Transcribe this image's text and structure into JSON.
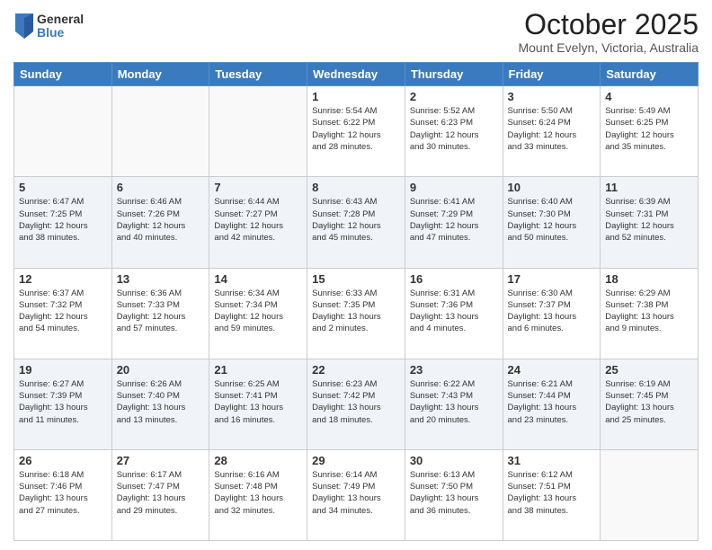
{
  "logo": {
    "general": "General",
    "blue": "Blue"
  },
  "header": {
    "month": "October 2025",
    "location": "Mount Evelyn, Victoria, Australia"
  },
  "days_of_week": [
    "Sunday",
    "Monday",
    "Tuesday",
    "Wednesday",
    "Thursday",
    "Friday",
    "Saturday"
  ],
  "weeks": [
    [
      {
        "day": "",
        "info": ""
      },
      {
        "day": "",
        "info": ""
      },
      {
        "day": "",
        "info": ""
      },
      {
        "day": "1",
        "info": "Sunrise: 5:54 AM\nSunset: 6:22 PM\nDaylight: 12 hours\nand 28 minutes."
      },
      {
        "day": "2",
        "info": "Sunrise: 5:52 AM\nSunset: 6:23 PM\nDaylight: 12 hours\nand 30 minutes."
      },
      {
        "day": "3",
        "info": "Sunrise: 5:50 AM\nSunset: 6:24 PM\nDaylight: 12 hours\nand 33 minutes."
      },
      {
        "day": "4",
        "info": "Sunrise: 5:49 AM\nSunset: 6:25 PM\nDaylight: 12 hours\nand 35 minutes."
      }
    ],
    [
      {
        "day": "5",
        "info": "Sunrise: 6:47 AM\nSunset: 7:25 PM\nDaylight: 12 hours\nand 38 minutes."
      },
      {
        "day": "6",
        "info": "Sunrise: 6:46 AM\nSunset: 7:26 PM\nDaylight: 12 hours\nand 40 minutes."
      },
      {
        "day": "7",
        "info": "Sunrise: 6:44 AM\nSunset: 7:27 PM\nDaylight: 12 hours\nand 42 minutes."
      },
      {
        "day": "8",
        "info": "Sunrise: 6:43 AM\nSunset: 7:28 PM\nDaylight: 12 hours\nand 45 minutes."
      },
      {
        "day": "9",
        "info": "Sunrise: 6:41 AM\nSunset: 7:29 PM\nDaylight: 12 hours\nand 47 minutes."
      },
      {
        "day": "10",
        "info": "Sunrise: 6:40 AM\nSunset: 7:30 PM\nDaylight: 12 hours\nand 50 minutes."
      },
      {
        "day": "11",
        "info": "Sunrise: 6:39 AM\nSunset: 7:31 PM\nDaylight: 12 hours\nand 52 minutes."
      }
    ],
    [
      {
        "day": "12",
        "info": "Sunrise: 6:37 AM\nSunset: 7:32 PM\nDaylight: 12 hours\nand 54 minutes."
      },
      {
        "day": "13",
        "info": "Sunrise: 6:36 AM\nSunset: 7:33 PM\nDaylight: 12 hours\nand 57 minutes."
      },
      {
        "day": "14",
        "info": "Sunrise: 6:34 AM\nSunset: 7:34 PM\nDaylight: 12 hours\nand 59 minutes."
      },
      {
        "day": "15",
        "info": "Sunrise: 6:33 AM\nSunset: 7:35 PM\nDaylight: 13 hours\nand 2 minutes."
      },
      {
        "day": "16",
        "info": "Sunrise: 6:31 AM\nSunset: 7:36 PM\nDaylight: 13 hours\nand 4 minutes."
      },
      {
        "day": "17",
        "info": "Sunrise: 6:30 AM\nSunset: 7:37 PM\nDaylight: 13 hours\nand 6 minutes."
      },
      {
        "day": "18",
        "info": "Sunrise: 6:29 AM\nSunset: 7:38 PM\nDaylight: 13 hours\nand 9 minutes."
      }
    ],
    [
      {
        "day": "19",
        "info": "Sunrise: 6:27 AM\nSunset: 7:39 PM\nDaylight: 13 hours\nand 11 minutes."
      },
      {
        "day": "20",
        "info": "Sunrise: 6:26 AM\nSunset: 7:40 PM\nDaylight: 13 hours\nand 13 minutes."
      },
      {
        "day": "21",
        "info": "Sunrise: 6:25 AM\nSunset: 7:41 PM\nDaylight: 13 hours\nand 16 minutes."
      },
      {
        "day": "22",
        "info": "Sunrise: 6:23 AM\nSunset: 7:42 PM\nDaylight: 13 hours\nand 18 minutes."
      },
      {
        "day": "23",
        "info": "Sunrise: 6:22 AM\nSunset: 7:43 PM\nDaylight: 13 hours\nand 20 minutes."
      },
      {
        "day": "24",
        "info": "Sunrise: 6:21 AM\nSunset: 7:44 PM\nDaylight: 13 hours\nand 23 minutes."
      },
      {
        "day": "25",
        "info": "Sunrise: 6:19 AM\nSunset: 7:45 PM\nDaylight: 13 hours\nand 25 minutes."
      }
    ],
    [
      {
        "day": "26",
        "info": "Sunrise: 6:18 AM\nSunset: 7:46 PM\nDaylight: 13 hours\nand 27 minutes."
      },
      {
        "day": "27",
        "info": "Sunrise: 6:17 AM\nSunset: 7:47 PM\nDaylight: 13 hours\nand 29 minutes."
      },
      {
        "day": "28",
        "info": "Sunrise: 6:16 AM\nSunset: 7:48 PM\nDaylight: 13 hours\nand 32 minutes."
      },
      {
        "day": "29",
        "info": "Sunrise: 6:14 AM\nSunset: 7:49 PM\nDaylight: 13 hours\nand 34 minutes."
      },
      {
        "day": "30",
        "info": "Sunrise: 6:13 AM\nSunset: 7:50 PM\nDaylight: 13 hours\nand 36 minutes."
      },
      {
        "day": "31",
        "info": "Sunrise: 6:12 AM\nSunset: 7:51 PM\nDaylight: 13 hours\nand 38 minutes."
      },
      {
        "day": "",
        "info": ""
      }
    ]
  ]
}
